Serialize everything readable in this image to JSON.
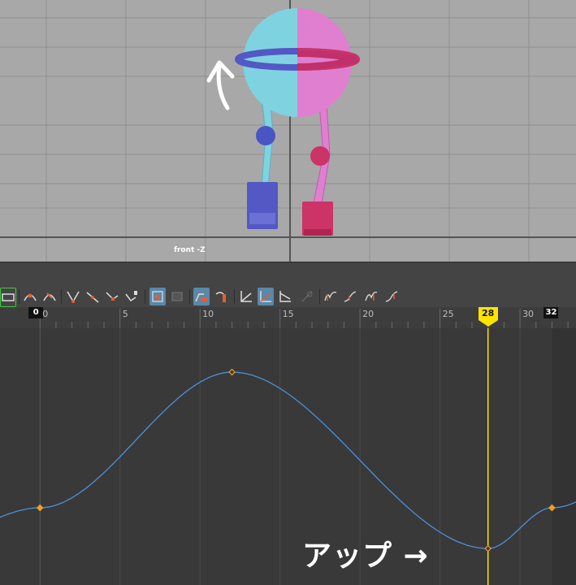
{
  "viewport": {
    "view_label": "front -Z",
    "rig_colors": {
      "left_side": "#7fd3e0",
      "right_side": "#e07fd0",
      "left_foot": "#5358c4",
      "right_foot": "#cc3366",
      "left_knee": "#4a55c4",
      "right_knee": "#cc3366"
    },
    "rotate_arrow_icon": "curved-up-arrow-icon"
  },
  "toolbar": {
    "buttons": [
      {
        "name": "key-stats-icon",
        "active": false
      },
      {
        "name": "insert-key-icon",
        "active": false
      },
      {
        "name": "lattice-deform-icon",
        "active": false
      },
      {
        "name": "tangent-auto-icon",
        "active": false
      },
      {
        "name": "tangent-spline-icon",
        "active": false
      },
      {
        "name": "tangent-linear-icon",
        "active": false
      },
      {
        "name": "tangent-stepped-icon",
        "active": false
      },
      {
        "name": "buffer-curve-icon",
        "active": true
      },
      {
        "name": "buffer-swap-icon",
        "active": false
      },
      {
        "name": "break-tangents-icon",
        "active": true
      },
      {
        "name": "unify-tangents-icon",
        "active": false
      },
      {
        "name": "lock-weights-icon",
        "active": false
      },
      {
        "name": "normalize-icon",
        "active": true
      },
      {
        "name": "denormalize-icon",
        "active": false
      },
      {
        "name": "snap-icon",
        "active": false
      },
      {
        "name": "pre-infinity-cycle-icon",
        "active": false
      },
      {
        "name": "pre-infinity-offset-icon",
        "active": false
      },
      {
        "name": "post-infinity-cycle-icon",
        "active": false
      },
      {
        "name": "post-infinity-offset-icon",
        "active": false
      }
    ]
  },
  "timeline": {
    "start_frame_flag": "0",
    "end_frame_flag": "32",
    "current_frame": "28",
    "tick_labels": [
      "0",
      "5",
      "10",
      "15",
      "20",
      "25",
      "30"
    ],
    "current_frame_color": "#ffe400"
  },
  "chart_data": {
    "type": "line",
    "x_range": [
      -2.5,
      33.5
    ],
    "series": [
      {
        "color": "#4d8fd8",
        "keyframes": [
          {
            "frame": 0,
            "value": 0
          },
          {
            "frame": 12,
            "value": 1
          },
          {
            "frame": 28,
            "value": -0.3
          },
          {
            "frame": 32,
            "value": 0
          }
        ],
        "key_color": "#f0a020"
      }
    ]
  },
  "annotation": {
    "text": "アップ →"
  }
}
